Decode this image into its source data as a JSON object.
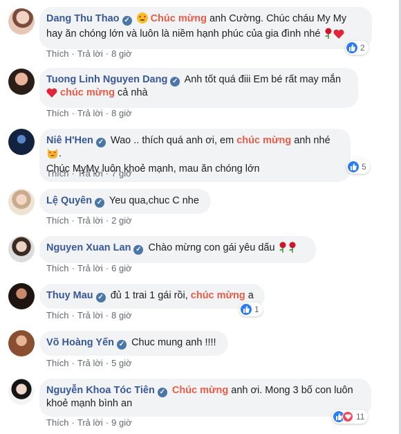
{
  "comments": [
    {
      "author": "Dang Thu Thao",
      "before": "",
      "highlight": "Chúc mừng",
      "after": " anh Cường. Chúc cháu My My hay ăn chóng lớn và luôn là niềm hạnh phúc của gia đình nhé",
      "like": "Thích",
      "reply": "Trả lời",
      "time": "8 giờ",
      "reactions": "2"
    },
    {
      "author": "Tuong Linh Nguyen Dang",
      "before": "Anh tốt quá điii Em bé rất may mắn",
      "highlight": "chúc mừng",
      "after": " cả nhà",
      "like": "Thích",
      "reply": "Trả lời",
      "time": "8 giờ"
    },
    {
      "author": "Niê H'Hen",
      "before": "Wao .. thích quá anh ơi, em ",
      "highlight": "chúc mừng",
      "after": " anh nhé",
      "line2": "Chúc MyMy luôn khoẻ mạnh, mau ăn chóng lớn",
      "like": "Thích",
      "reply": "Trả lời",
      "time": "7 giờ",
      "reactions": "5"
    },
    {
      "author": "Lệ Quyên",
      "text": "Yeu qua,chuc C nhe",
      "like": "Thích",
      "reply": "Trả lời",
      "time": "2 giờ"
    },
    {
      "author": "Nguyen Xuan Lan",
      "text": "Chào mừng con gái yêu dấu",
      "like": "Thích",
      "reply": "Trả lời",
      "time": "6 giờ"
    },
    {
      "author": "Thuy Mau",
      "before": "đủ 1 trai 1 gái rồi, ",
      "highlight": "chúc mừng",
      "after": " a",
      "like": "Thích",
      "reply": "Trả lời",
      "time": "8 giờ",
      "reactions": "1"
    },
    {
      "author": "Võ Hoàng Yến",
      "text": "Chuc mung anh !!!!",
      "like": "Thích",
      "reply": "Trả lời",
      "time": "5 giờ"
    },
    {
      "author": "Nguyễn Khoa Tóc Tiên",
      "before": "",
      "highlight": "Chúc mừng",
      "after": " anh ơi. Mong 3 bố con luôn khoẻ mạnh bình an",
      "like": "Thích",
      "reply": "Trả lời",
      "time": "9 giờ",
      "reactions": "11"
    }
  ],
  "colors": {
    "author": "#385898",
    "highlight": "#e95b47",
    "bubble": "#f2f3f5",
    "meta": "#616770",
    "like": "#2e7bf6",
    "heart": "#f2485a"
  },
  "icons": [
    "verified-badge-icon",
    "heart-eyes-emoji-icon",
    "rose-icon",
    "red-heart-icon",
    "heart-eyes-cat-icon",
    "like-reaction-icon",
    "love-reaction-icon"
  ]
}
